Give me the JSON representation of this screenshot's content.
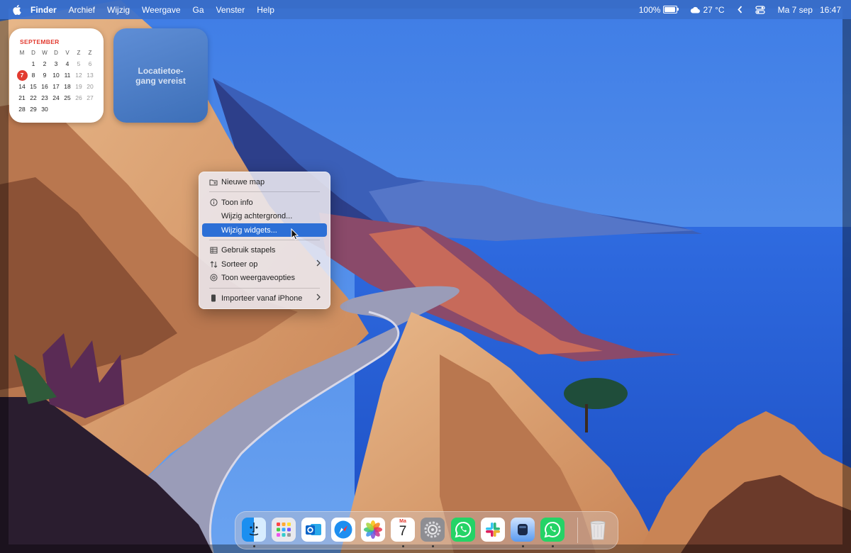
{
  "menubar": {
    "apple_icon": "apple-logo-icon",
    "app_name": "Finder",
    "menus": [
      "Archief",
      "Wijzig",
      "Weergave",
      "Ga",
      "Venster",
      "Help"
    ],
    "battery_percent": "100%",
    "weather": "27 °C",
    "date": "Ma 7 sep",
    "time": "16:47"
  },
  "calendar_widget": {
    "month": "SEPTEMBER",
    "weekdays": [
      "M",
      "D",
      "W",
      "D",
      "V",
      "Z",
      "Z"
    ],
    "weeks": [
      [
        "",
        "1",
        "2",
        "3",
        "4",
        "5",
        "6"
      ],
      [
        "7",
        "8",
        "9",
        "10",
        "11",
        "12",
        "13"
      ],
      [
        "14",
        "15",
        "16",
        "17",
        "18",
        "19",
        "20"
      ],
      [
        "21",
        "22",
        "23",
        "24",
        "25",
        "26",
        "27"
      ],
      [
        "28",
        "29",
        "30",
        "",
        "",
        "",
        ""
      ]
    ],
    "today": "7"
  },
  "location_widget": {
    "text": "Locatietoe-gang vereist"
  },
  "context_menu": {
    "items": [
      {
        "label": "Nieuwe map",
        "icon": "folder-plus-icon"
      },
      {
        "label": "Toon info",
        "icon": "info-circle-icon"
      },
      {
        "label": "Wijzig achtergrond...",
        "icon": ""
      },
      {
        "label": "Wijzig widgets...",
        "icon": "",
        "highlighted": true
      },
      {
        "label": "Gebruik stapels",
        "icon": "stack-grid-icon"
      },
      {
        "label": "Sorteer op",
        "icon": "sort-arrows-icon",
        "submenu": true
      },
      {
        "label": "Toon weergaveopties",
        "icon": "view-options-icon"
      },
      {
        "label": "Importeer vanaf iPhone",
        "icon": "iphone-icon",
        "submenu": true
      }
    ]
  },
  "dock": {
    "apps": [
      {
        "name": "Finder",
        "icon": "finder-icon"
      },
      {
        "name": "Launchpad",
        "icon": "launchpad-icon"
      },
      {
        "name": "Outlook",
        "icon": "outlook-icon"
      },
      {
        "name": "Safari",
        "icon": "safari-icon"
      },
      {
        "name": "Foto's",
        "icon": "photos-icon"
      },
      {
        "name": "Agenda",
        "icon": "calendar-icon",
        "month": "Ma",
        "day": "7"
      },
      {
        "name": "Systeeminstellingen",
        "icon": "system-settings-icon"
      },
      {
        "name": "WhatsApp",
        "icon": "whatsapp-icon"
      },
      {
        "name": "Slack",
        "icon": "slack-icon"
      },
      {
        "name": "Opslag",
        "icon": "storage-icon"
      },
      {
        "name": "WhatsApp Beta",
        "icon": "whatsapp-beta-icon"
      },
      {
        "name": "Prullenmand",
        "icon": "trash-icon"
      }
    ]
  },
  "colors": {
    "menubar": "#3a70cd",
    "accent": "#2c6fd6",
    "calendar_today": "#e23b30"
  }
}
